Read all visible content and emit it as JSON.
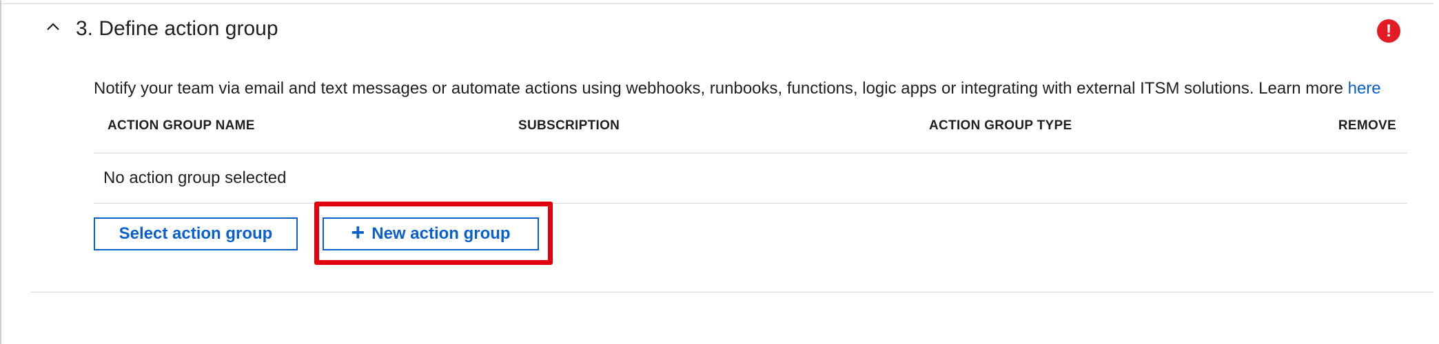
{
  "section": {
    "title": "3. Define action group",
    "has_error": true,
    "error_glyph": "!",
    "error_color": "#e41a24"
  },
  "description": {
    "text": "Notify your team via email and text messages or automate actions using webhooks, runbooks, functions, logic apps or integrating with external ITSM solutions. Learn more",
    "link_label": "here"
  },
  "table": {
    "columns": [
      "ACTION GROUP NAME",
      "SUBSCRIPTION",
      "ACTION GROUP TYPE",
      "REMOVE"
    ],
    "empty_message": "No action group selected"
  },
  "buttons": {
    "select_label": "Select action group",
    "new_label": "New action group",
    "new_icon": "plus-icon",
    "accent_color": "#0a5fcf"
  },
  "annotation": {
    "highlight_target": "new-action-group-button",
    "highlight_color": "#e0000e"
  }
}
